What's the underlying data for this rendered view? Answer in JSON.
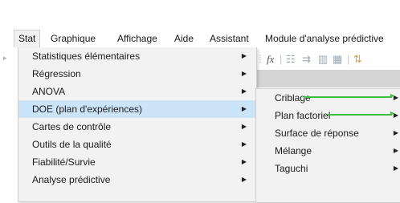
{
  "menubar": [
    {
      "label": "Stat",
      "active": true
    },
    {
      "label": "Graphique"
    },
    {
      "label": "Affichage"
    },
    {
      "label": "Aide"
    },
    {
      "label": "Assistant"
    },
    {
      "label": "Module d'analyse prédictive"
    }
  ],
  "stat_menu": [
    {
      "label": "Statistiques élémentaires",
      "submenu": true
    },
    {
      "label": "Régression",
      "submenu": true
    },
    {
      "label": "ANOVA",
      "submenu": true
    },
    {
      "label": "DOE (plan d'expériences)",
      "submenu": true,
      "highlighted": true
    },
    {
      "label": "Cartes de contrôle",
      "submenu": true
    },
    {
      "label": "Outils de la qualité",
      "submenu": true
    },
    {
      "label": "Fiabilité/Survie",
      "submenu": true
    },
    {
      "label": "Analyse prédictive",
      "submenu": true
    }
  ],
  "doe_menu": [
    {
      "label": "Criblage",
      "submenu": true
    },
    {
      "label": "Plan factoriel",
      "submenu": true
    },
    {
      "label": "Surface de réponse",
      "submenu": true
    },
    {
      "label": "Mélange",
      "submenu": true
    },
    {
      "label": "Taguchi",
      "submenu": true
    }
  ],
  "toolbar": {
    "fx_label": "fx"
  },
  "icons": {
    "submenu_arrow": "▶",
    "left_marker": "▸"
  },
  "colors": {
    "highlight": "#cce4f7",
    "annotation_arrow": "#3fbf3f",
    "menu_bg": "#f2f2f2"
  }
}
